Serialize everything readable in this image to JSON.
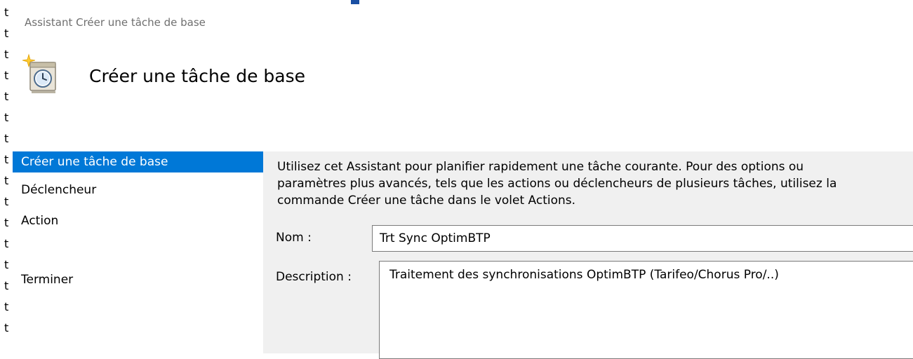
{
  "window": {
    "title": "Assistant Créer une tâche de base"
  },
  "header": {
    "title": "Créer une tâche de base",
    "icon": "task-clock-icon"
  },
  "left_edge": {
    "chars": [
      "t",
      "t",
      "t",
      "t",
      "t",
      "t",
      "t",
      "t",
      "t",
      "t",
      "t",
      "t",
      "t",
      "t",
      "t",
      "t"
    ]
  },
  "sidebar": {
    "items": [
      {
        "label": "Créer une tâche de base",
        "active": true
      },
      {
        "label": "Déclencheur",
        "active": false
      },
      {
        "label": "Action",
        "active": false
      },
      {
        "label": "Terminer",
        "active": false
      }
    ]
  },
  "main": {
    "intro": "Utilisez cet Assistant pour planifier rapidement une tâche courante. Pour des options ou\nparamètres plus avancés, tels que les actions ou déclencheurs de plusieurs tâches, utilisez la\ncommande Créer une tâche dans le volet Actions.",
    "name_label": "Nom :",
    "name_value": "Trt Sync OptimBTP",
    "description_label": "Description :",
    "description_value": "Traitement des synchronisations OptimBTP (Tarifeo/Chorus Pro/..)"
  },
  "colors": {
    "accent": "#0078d7",
    "panel": "#f0f0f0",
    "muted_text": "#6f6f6f"
  }
}
